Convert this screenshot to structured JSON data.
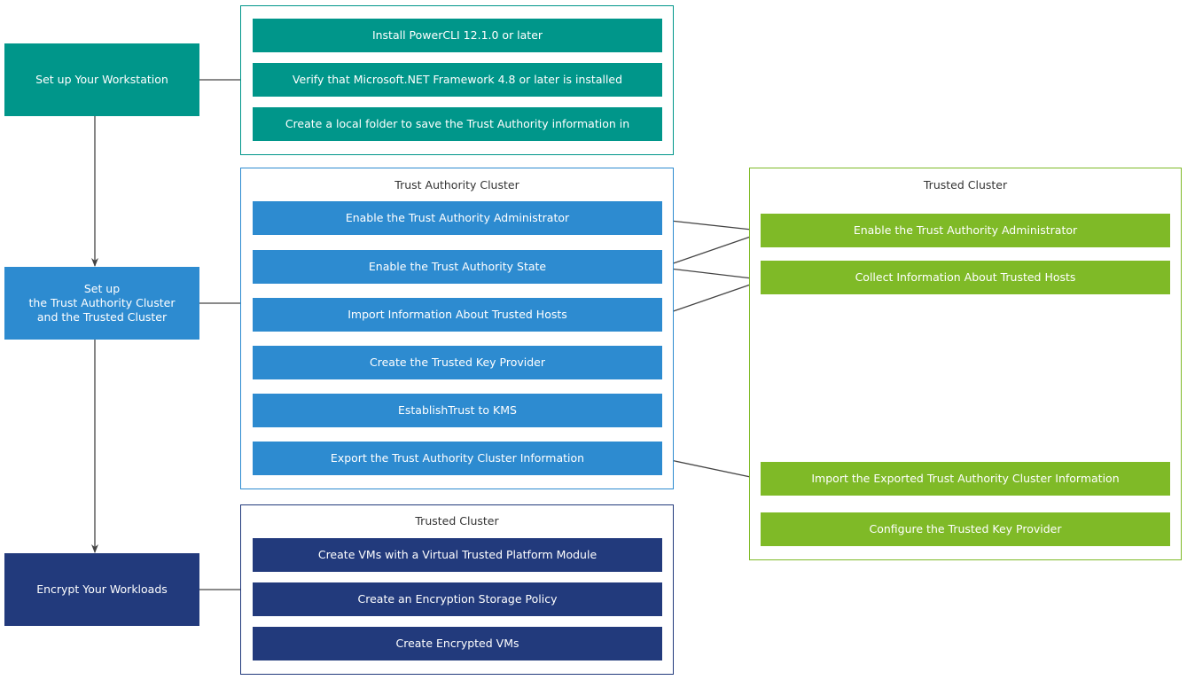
{
  "colors": {
    "teal": "#00968a",
    "blue": "#2d8bd0",
    "navy": "#223a7c",
    "green": "#7fba27",
    "connector": "#444444"
  },
  "phases": [
    {
      "label": "Set up Your Workstation"
    },
    {
      "label": "Set up\nthe Trust Authority Cluster\nand the Trusted Cluster"
    },
    {
      "label": "Encrypt Your Workloads"
    }
  ],
  "workstation_steps": [
    "Install PowerCLI 12.1.0 or later",
    "Verify that Microsoft.NET Framework 4.8 or later is installed",
    "Create a local folder to save the Trust Authority information in"
  ],
  "trust_authority_cluster": {
    "title": "Trust Authority Cluster",
    "steps": [
      "Enable the Trust Authority Administrator",
      "Enable the Trust Authority State",
      "Import Information About Trusted Hosts",
      "Create the Trusted Key Provider",
      "EstablishTrust to KMS",
      "Export the Trust Authority Cluster Information"
    ]
  },
  "trusted_cluster_setup": {
    "title": "Trusted Cluster",
    "steps": [
      "Enable the Trust Authority Administrator",
      "Collect Information About Trusted Hosts",
      "Import the Exported Trust Authority Cluster Information",
      "Configure the Trusted Key Provider"
    ]
  },
  "trusted_cluster_workloads": {
    "title": "Trusted Cluster",
    "steps": [
      "Create VMs with a Virtual Trusted Platform Module",
      "Create an Encryption Storage Policy",
      "Create Encrypted VMs"
    ]
  }
}
